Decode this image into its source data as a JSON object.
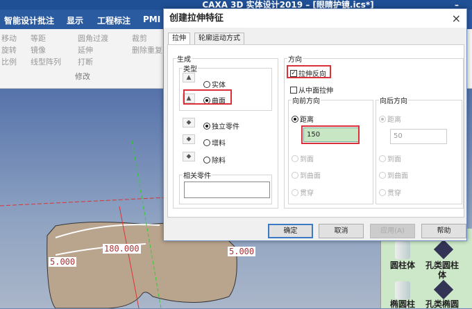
{
  "app": {
    "title": "CAXA 3D 实体设计2019 – [眼睛护镜.ics*]"
  },
  "menu": [
    "智能设计批注",
    "显示",
    "工程标注",
    "PMI"
  ],
  "ribbon": {
    "items": [
      "移动",
      "等距",
      "旋转",
      "镜像",
      "比例",
      "线型阵列",
      "圆角过渡",
      "延伸",
      "打断",
      "裁剪",
      "删除重复"
    ],
    "group_label": "修改"
  },
  "viewport": {
    "dims": [
      "180.000",
      "5.000",
      "5.000"
    ]
  },
  "panel": {
    "items": [
      "圆柱体",
      "孔类圆柱体",
      "椭圆柱",
      "孔类椭圆"
    ]
  },
  "dialog": {
    "title": "创建拉伸特征",
    "close": "×",
    "tabs": [
      "拉伸",
      "轮廓运动方式"
    ],
    "generate": {
      "label": "生成",
      "type_label": "类型",
      "solid": "实体",
      "surface": "曲面",
      "independent": "独立零件",
      "add": "增料",
      "remove": "除料",
      "related_label": "相关零件",
      "related_value": ""
    },
    "direction": {
      "label": "方向",
      "reverse": "拉伸反向",
      "reverse_checked": true,
      "midplane": "从中面拉伸",
      "midplane_checked": false,
      "forward": {
        "label": "向前方向",
        "distance": "距离",
        "value": "150",
        "to_face": "到面",
        "to_surface": "到曲面",
        "through": "贯穿"
      },
      "backward": {
        "label": "向后方向",
        "distance": "距离",
        "value": "50",
        "to_face": "到面",
        "to_surface": "到曲面",
        "through": "贯穿"
      }
    },
    "buttons": {
      "ok": "确定",
      "cancel": "取消",
      "apply": "应用(A)",
      "help": "帮助"
    }
  }
}
